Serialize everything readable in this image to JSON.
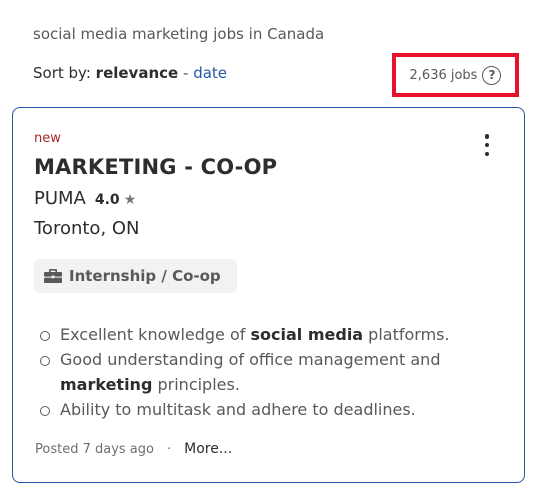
{
  "search": {
    "query_text": "social media marketing jobs in Canada"
  },
  "sort": {
    "prefix": "Sort by:",
    "active": "relevance",
    "separator": "-",
    "alternative": "date"
  },
  "results": {
    "count_text": "2,636 jobs",
    "help_glyph": "?"
  },
  "job": {
    "new_label": "new",
    "title": "MARKETING - CO-OP",
    "company": "PUMA",
    "rating": "4.0",
    "rating_glyph": "★",
    "location": "Toronto, ON",
    "job_type": "Internship / Co-op",
    "snippet": [
      {
        "before": "Excellent knowledge of ",
        "bold": "social media",
        "after": " platforms."
      },
      {
        "before": "Good understanding of office management and ",
        "bold": "marketing",
        "after": " principles."
      },
      {
        "before": "Ability to multitask and adhere to deadlines.",
        "bold": "",
        "after": ""
      }
    ],
    "posted": "Posted 7 days ago",
    "footer_dot": "·",
    "more_label": "More..."
  },
  "colors": {
    "link": "#2557a7",
    "highlight_box": "#e8112d",
    "new_tag": "#a9252b",
    "card_border": "#2557a7"
  },
  "icons": {
    "help": "question-circle-icon",
    "menu": "kebab-menu-icon",
    "star": "star-icon",
    "job_type": "briefcase-icon"
  }
}
